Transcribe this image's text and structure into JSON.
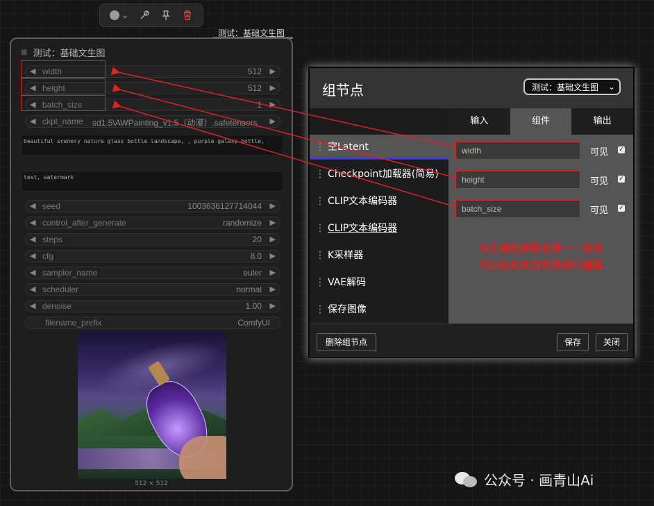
{
  "group": {
    "title": "测试：基础文生图"
  },
  "node": {
    "title": "测试：基础文生图",
    "widgets": [
      {
        "name": "width",
        "value": "512"
      },
      {
        "name": "height",
        "value": "512"
      },
      {
        "name": "batch_size",
        "value": "1"
      },
      {
        "name": "ckpt_name",
        "value": "sd1.5\\AWPainting_v1.5（动漫）.safetensors"
      }
    ],
    "prompt_positive": "beautiful scenery nature glass bottle landscape, , purple galaxy bottle,",
    "prompt_negative": "text, watermark",
    "sampler_widgets": [
      {
        "name": "seed",
        "value": "1003636127714044"
      },
      {
        "name": "control_after_generate",
        "value": "randomize"
      },
      {
        "name": "steps",
        "value": "20"
      },
      {
        "name": "cfg",
        "value": "8.0"
      },
      {
        "name": "sampler_name",
        "value": "euler"
      },
      {
        "name": "scheduler",
        "value": "normal"
      },
      {
        "name": "denoise",
        "value": "1.00"
      }
    ],
    "filename_prefix": {
      "name": "filename_prefix",
      "value": "ComfyUI"
    },
    "image_size": "512 × 512"
  },
  "dialog": {
    "title": "组节点",
    "select_value": "测试：基础文生图",
    "tabs": [
      "输入",
      "组件",
      "输出"
    ],
    "active_tab": 1,
    "nodes": [
      "空Latent",
      "Checkpoint加载器(简易)",
      "CLIP文本编码器",
      "CLIP文本编码器",
      "K采样器",
      "VAE解码",
      "保存图像"
    ],
    "fields": [
      {
        "value": "width",
        "visible_label": "可见",
        "checked": true
      },
      {
        "value": "height",
        "visible_label": "可见",
        "checked": true
      },
      {
        "value": "batch_size",
        "visible_label": "可见",
        "checked": true
      }
    ],
    "note_lines": [
      "与左侧的参数名称一一对应",
      "可以在此处对名称进行编辑"
    ],
    "buttons": {
      "delete": "删除组节点",
      "save": "保存",
      "close": "关闭"
    }
  },
  "watermark": "公众号 · 画青山Ai",
  "colors": {
    "annotation_red": "#dd2222",
    "background": "#151515",
    "selected_underline": "#2a2aff"
  }
}
